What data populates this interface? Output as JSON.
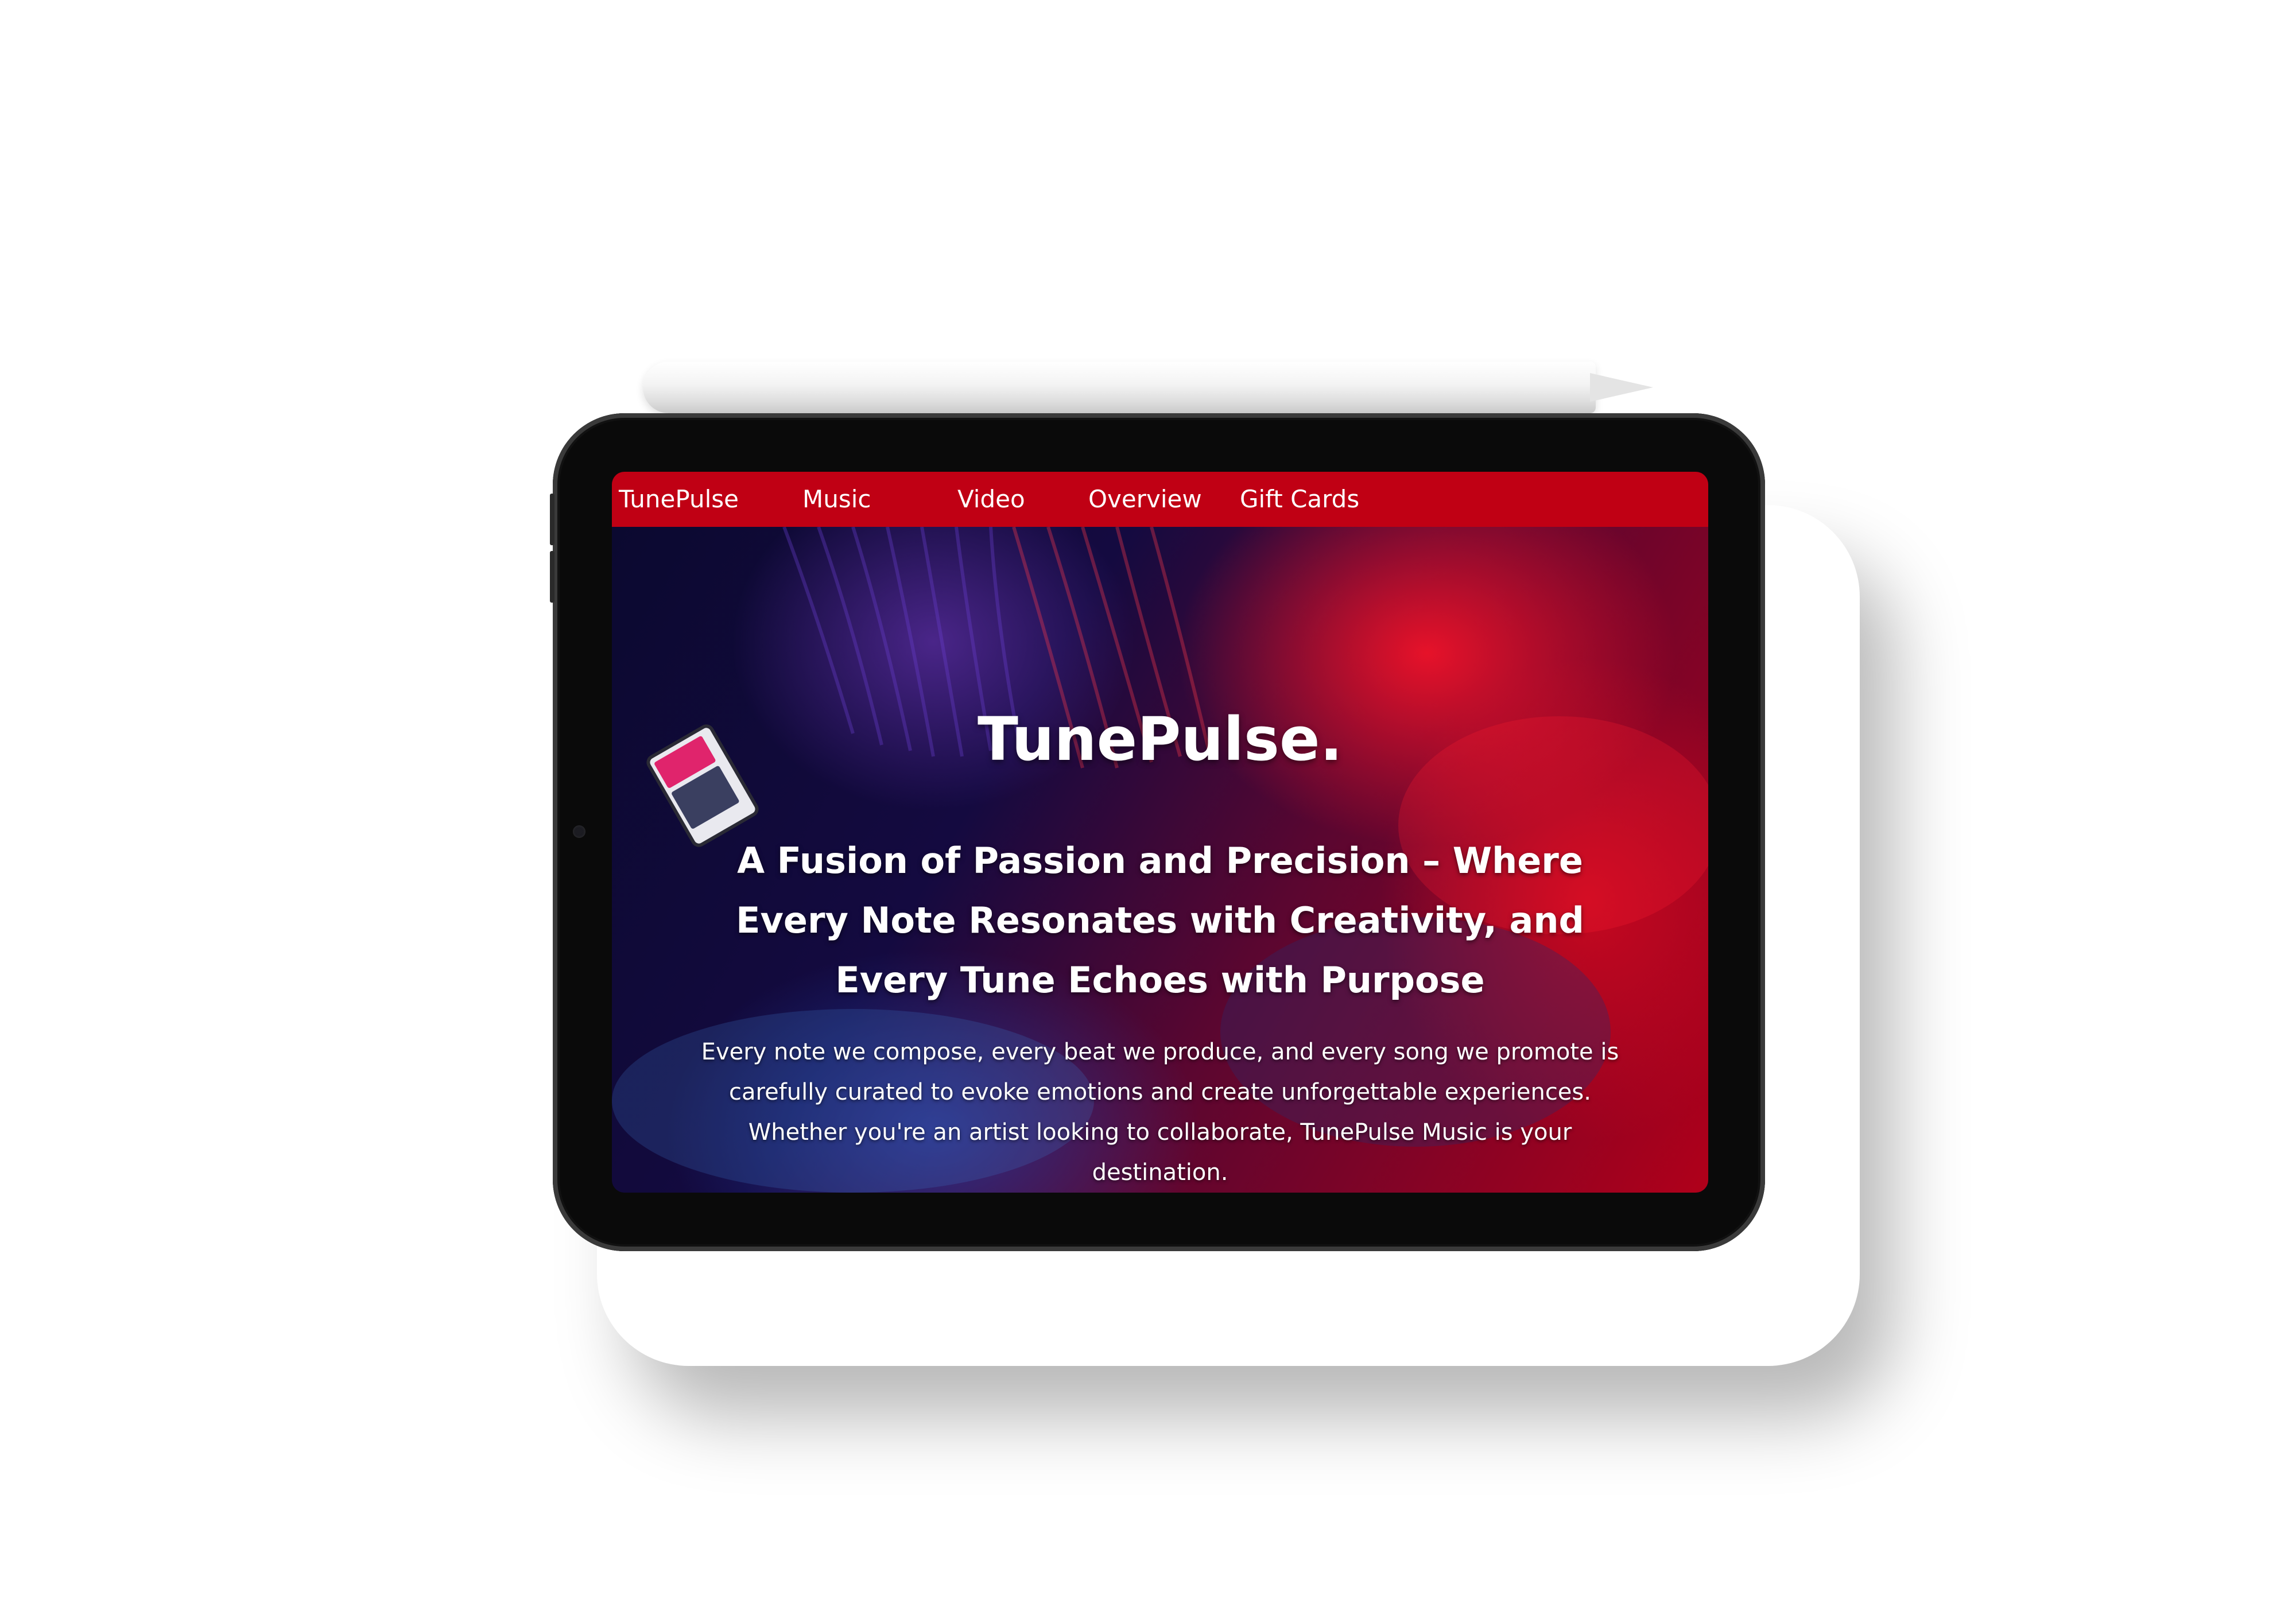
{
  "nav": {
    "items": [
      {
        "label": "TunePulse"
      },
      {
        "label": "Music"
      },
      {
        "label": "Video"
      },
      {
        "label": "Overview"
      },
      {
        "label": "Gift Cards"
      }
    ]
  },
  "hero": {
    "title": "TunePulse.",
    "subtitle": "A Fusion of Passion and Precision – Where Every Note Resonates with Creativity, and Every Tune Echoes with Purpose",
    "body": "Every note we compose, every beat we produce, and every song we promote is carefully curated to evoke emotions and create unforgettable experiences. Whether you're an artist looking to collaborate, TunePulse Music is your destination."
  },
  "colors": {
    "nav_background": "#c00014",
    "text": "#ffffff",
    "hero_dark": "#0b0930",
    "hero_red": "#b0001a"
  },
  "icons": {
    "stylus": "apple-pencil",
    "camera": "front-camera"
  }
}
